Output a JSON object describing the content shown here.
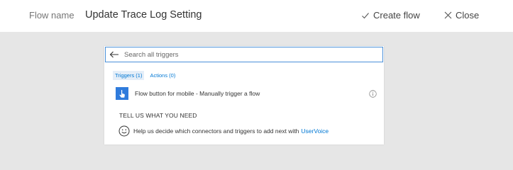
{
  "header": {
    "flow_name_label": "Flow name",
    "flow_name_value": "Update Trace Log Setting",
    "create_flow_label": "Create flow",
    "close_label": "Close"
  },
  "search": {
    "placeholder": "Search all triggers",
    "value": ""
  },
  "tabs": [
    {
      "label": "Triggers (1)",
      "active": true
    },
    {
      "label": "Actions (0)",
      "active": false
    }
  ],
  "triggers": [
    {
      "label": "Flow button for mobile - Manually trigger a flow",
      "icon": "hand-tap-icon",
      "icon_bg": "#2f7bdc"
    }
  ],
  "feedback": {
    "heading": "TELL US WHAT YOU NEED",
    "text": "Help us decide which connectors and triggers to add next with",
    "link_label": "UserVoice"
  },
  "colors": {
    "accent": "#0078d4",
    "search_border": "#4a90d9",
    "page_bg": "#e6e6e6"
  }
}
